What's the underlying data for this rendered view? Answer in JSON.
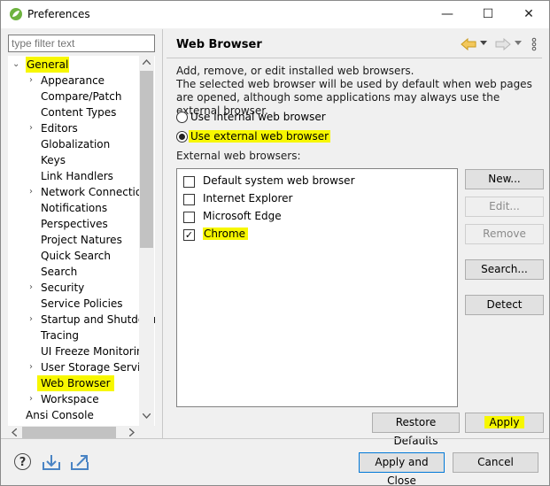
{
  "window": {
    "title": "Preferences",
    "controls": {
      "minimize": "—",
      "maximize": "☐",
      "close": "✕"
    }
  },
  "filter": {
    "placeholder": "type filter text"
  },
  "tree": {
    "items": [
      {
        "label": "General",
        "expander": "⌄"
      },
      {
        "label": "Appearance",
        "expander": "›"
      },
      {
        "label": "Compare/Patch",
        "expander": ""
      },
      {
        "label": "Content Types",
        "expander": ""
      },
      {
        "label": "Editors",
        "expander": "›"
      },
      {
        "label": "Globalization",
        "expander": ""
      },
      {
        "label": "Keys",
        "expander": ""
      },
      {
        "label": "Link Handlers",
        "expander": ""
      },
      {
        "label": "Network Connections",
        "expander": "›"
      },
      {
        "label": "Notifications",
        "expander": ""
      },
      {
        "label": "Perspectives",
        "expander": ""
      },
      {
        "label": "Project Natures",
        "expander": ""
      },
      {
        "label": "Quick Search",
        "expander": ""
      },
      {
        "label": "Search",
        "expander": ""
      },
      {
        "label": "Security",
        "expander": "›"
      },
      {
        "label": "Service Policies",
        "expander": ""
      },
      {
        "label": "Startup and Shutdown",
        "expander": "›"
      },
      {
        "label": "Tracing",
        "expander": ""
      },
      {
        "label": "UI Freeze Monitoring",
        "expander": ""
      },
      {
        "label": "User Storage Service",
        "expander": "›"
      },
      {
        "label": "Web Browser",
        "expander": ""
      },
      {
        "label": "Workspace",
        "expander": "›"
      },
      {
        "label": "Ansi Console",
        "expander": ""
      }
    ]
  },
  "page": {
    "title": "Web Browser",
    "description": "Add, remove, or edit installed web browsers.\nThe selected web browser will be used by default when web pages are opened, although some applications may always use the external browser.",
    "radio_internal": "Use internal web browser",
    "radio_external": "Use external web browser",
    "list_label": "External web browsers:",
    "browsers": [
      {
        "name": "Default system web browser",
        "checked": ""
      },
      {
        "name": "Internet Explorer",
        "checked": ""
      },
      {
        "name": "Microsoft Edge",
        "checked": ""
      },
      {
        "name": "Chrome",
        "checked": "✓"
      }
    ],
    "buttons": {
      "new": "New...",
      "edit": "Edit...",
      "remove": "Remove",
      "search": "Search...",
      "detect": "Detect"
    },
    "restore_defaults": "Restore Defaults",
    "apply": "Apply"
  },
  "footer": {
    "help": "?",
    "apply_close": "Apply and Close",
    "cancel": "Cancel"
  },
  "colors": {
    "highlight": "#f7f700",
    "accent": "#0078d7"
  }
}
